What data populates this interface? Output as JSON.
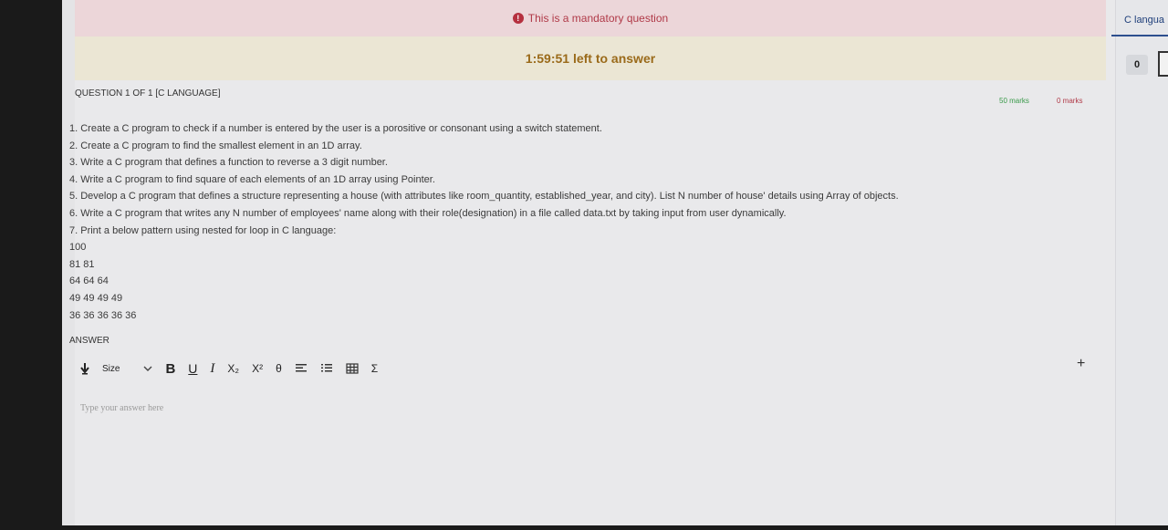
{
  "banner": {
    "mandatory_icon": "!",
    "mandatory_text": "This is a mandatory question",
    "timer_text": "1:59:51 left to answer"
  },
  "sidebar": {
    "tab_label": "C langua",
    "badge": "0"
  },
  "question": {
    "title": "QUESTION 1 OF 1 [C LANGUAGE]",
    "marks_total": "50 marks",
    "marks_scored": "0 marks",
    "lines": [
      "1. Create a C program to check if a number is entered by the user is a porositive or consonant using a switch statement.",
      "2. Create a C program to find the smallest element in an 1D array.",
      "3. Write a C program that defines a function to reverse a 3 digit number.",
      "4. Write a C program to find square of each elements of an 1D array using Pointer.",
      "5. Develop a C program that defines a structure representing a house (with attributes like room_quantity, established_year, and city). List N number of house' details using Array of objects.",
      "6. Write a C program that writes any N number of employees' name along with their role(designation) in a file called data.txt by taking input from user dynamically.",
      "7. Print a below pattern using nested for loop in C language:",
      "100",
      "81 81",
      "64 64 64",
      "49 49 49 49",
      "36 36 36 36 36"
    ]
  },
  "answer": {
    "label": "ANSWER",
    "placeholder": "Type your answer here"
  },
  "toolbar": {
    "size_label": "Size",
    "bold": "B",
    "underline": "U",
    "italic": "I",
    "subscript": "X₂",
    "superscript": "X²",
    "theta": "θ",
    "sigma": "Σ",
    "plus": "+"
  }
}
